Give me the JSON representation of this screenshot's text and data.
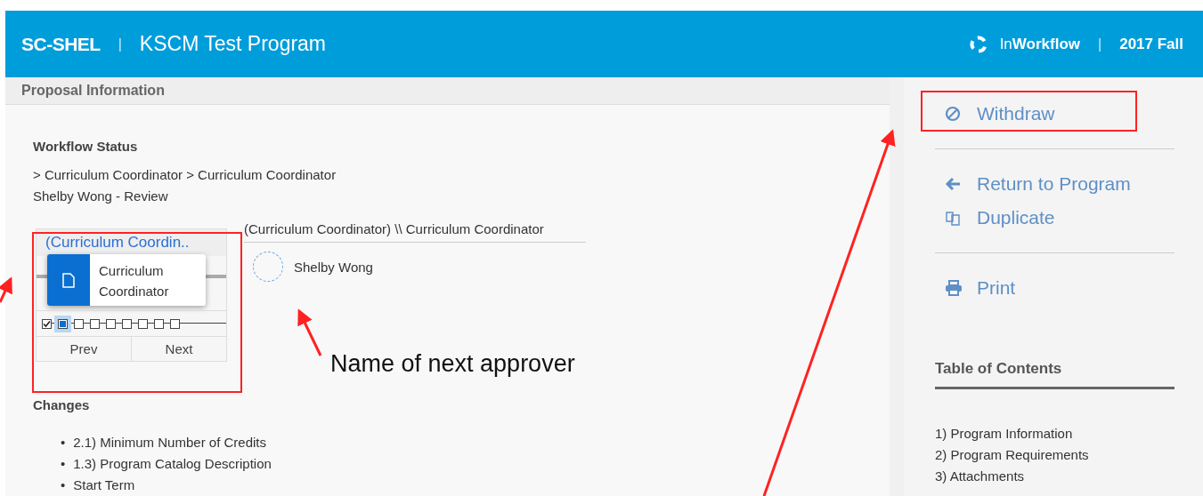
{
  "header": {
    "brand": "SC-SHEL",
    "separator": "|",
    "program": "KSCM Test Program",
    "app_name": "In**Workflow**",
    "separator_right": "|",
    "term": "2017 Fall"
  },
  "proposal": {
    "title": "Proposal Information",
    "workflow_heading": "Workflow Status",
    "path": "> Curriculum Coordinator > Curriculum Coordinator",
    "current": "Shelby Wong - Review",
    "widget": {
      "title": "(Curriculum Coordin..",
      "popup_label": "Curriculum Coordinator",
      "steps": [
        {
          "done": true,
          "selected": false
        },
        {
          "done": false,
          "selected": true
        },
        {
          "done": false,
          "selected": false
        },
        {
          "done": false,
          "selected": false
        },
        {
          "done": false,
          "selected": false
        },
        {
          "done": false,
          "selected": false
        },
        {
          "done": false,
          "selected": false
        },
        {
          "done": false,
          "selected": false
        },
        {
          "done": false,
          "selected": false
        }
      ],
      "prev": "Prev",
      "next": "Next"
    },
    "role_title": "(Curriculum Coordinator) \\\\ Curriculum Coordinator",
    "approver": "Shelby Wong",
    "changes_heading": "Changes",
    "changes": [
      {
        "bullet": "•",
        "text": "2.1) Minimum Number of Credits"
      },
      {
        "bullet": "•",
        "text": "1.3) Program Catalog Description"
      },
      {
        "bullet": "•",
        "text": "Start Term"
      }
    ]
  },
  "sidebar": {
    "actions": [
      {
        "kind": "withdraw",
        "label": "Withdraw"
      },
      {
        "kind": "divider"
      },
      {
        "kind": "return",
        "label": "Return to Program"
      },
      {
        "kind": "duplicate",
        "label": "Duplicate"
      },
      {
        "kind": "divider"
      },
      {
        "kind": "print",
        "label": "Print"
      }
    ],
    "toc_heading": "Table of Contents",
    "toc": [
      "1) Program Information",
      "2) Program Requirements",
      "3) Attachments"
    ]
  },
  "annotations": {
    "callout": "Name of next approver"
  }
}
